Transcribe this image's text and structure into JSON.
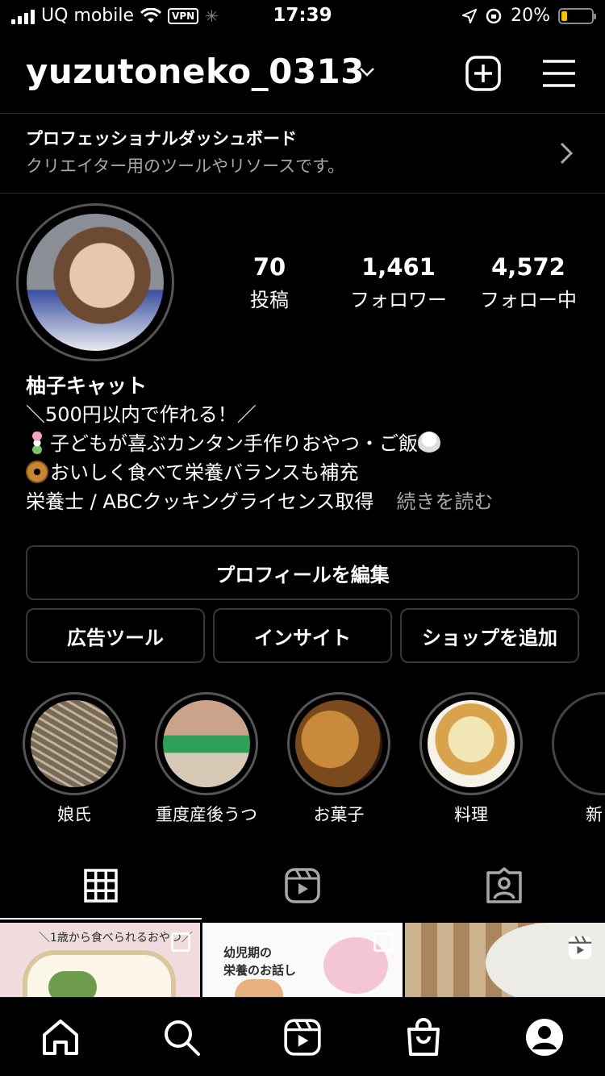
{
  "status_bar": {
    "carrier": "UQ mobile",
    "vpn": "VPN",
    "time": "17:39",
    "battery_percent": "20%",
    "battery_level": 0.2,
    "battery_color": "#f3c400"
  },
  "header": {
    "username": "yuzutoneko_0313"
  },
  "dashboard": {
    "title": "プロフェッショナルダッシュボード",
    "subtitle": "クリエイター用のツールやリソースです。"
  },
  "stats": [
    {
      "value": "70",
      "label": "投稿"
    },
    {
      "value": "1,461",
      "label": "フォロワー"
    },
    {
      "value": "4,572",
      "label": "フォロー中"
    }
  ],
  "bio": {
    "name": "柚子キャット",
    "line1": "＼500円以内で作れる！／",
    "line2": "子どもが喜ぶカンタン手作りおやつ・ご飯",
    "line3": "おいしく食べて栄養バランスも補充",
    "line4": "栄養士 / ABCクッキングライセンス取得",
    "more": "続きを読む"
  },
  "buttons": {
    "edit_profile": "プロフィールを編集",
    "ad_tools": "広告ツール",
    "insights": "インサイト",
    "add_shop": "ショップを追加"
  },
  "highlights": [
    {
      "label": "娘氏"
    },
    {
      "label": "重度産後うつ"
    },
    {
      "label": "お菓子"
    },
    {
      "label": "料理"
    },
    {
      "label": "新"
    }
  ],
  "thumbnails": {
    "thumb1_text": "＼1歳から食べられるおやつ／",
    "thumb2_text": "幼児期の",
    "thumb2_text2": "栄養のお話し"
  },
  "icons": {
    "add": "plus-square-icon",
    "menu": "hamburger-menu-icon",
    "grid": "grid-icon",
    "reels": "reels-icon",
    "tagged": "tagged-person-icon",
    "home": "home-icon",
    "search": "search-icon",
    "shop": "shopping-bag-icon",
    "profile": "profile-icon"
  }
}
